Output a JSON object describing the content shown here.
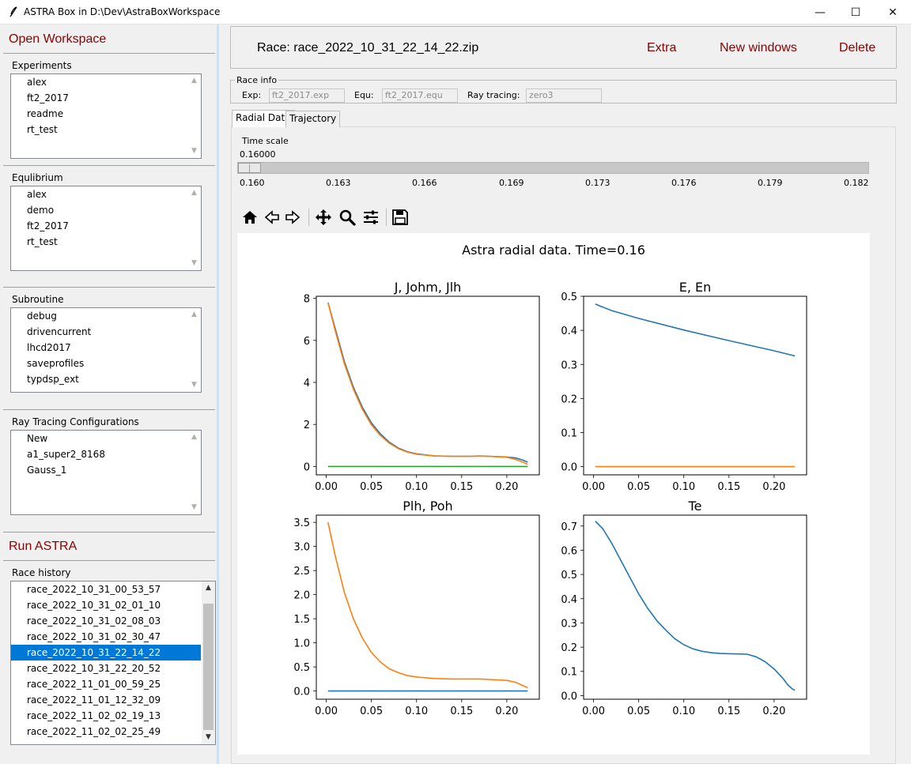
{
  "window": {
    "title": "ASTRA Box in D:\\Dev\\AstraBoxWorkspace",
    "minimize": "—",
    "maximize": "☐",
    "close": "✕"
  },
  "sidebar": {
    "open_workspace": "Open Workspace",
    "experiments": {
      "label": "Experiments",
      "items": [
        "alex",
        "ft2_2017",
        "readme",
        "rt_test"
      ]
    },
    "equilibrium": {
      "label": "Equlibrium",
      "items": [
        "alex",
        "demo",
        "ft2_2017",
        "rt_test"
      ]
    },
    "subroutine": {
      "label": "Subroutine",
      "items": [
        "debug",
        "drivencurrent",
        "lhcd2017",
        "saveprofiles",
        "typdsp_ext"
      ]
    },
    "ray_tracing": {
      "label": "Ray Tracing Configurations",
      "items": [
        "New",
        "a1_super2_8168",
        "Gauss_1"
      ]
    },
    "run_astra": "Run ASTRA",
    "race_history": {
      "label": "Race history",
      "selected_index": 4,
      "items": [
        "race_2022_10_31_00_53_57",
        "race_2022_10_31_02_01_10",
        "race_2022_10_31_02_08_03",
        "race_2022_10_31_02_30_47",
        "race_2022_10_31_22_14_22",
        "race_2022_10_31_22_20_52",
        "race_2022_11_01_00_59_25",
        "race_2022_11_01_12_32_09",
        "race_2022_11_02_02_19_13",
        "race_2022_11_02_02_25_49"
      ]
    }
  },
  "race": {
    "title": "Race: race_2022_10_31_22_14_22.zip",
    "extra": "Extra",
    "new_windows": "New windows",
    "delete": "Delete"
  },
  "race_info": {
    "legend": "Race info",
    "exp_label": "Exp:",
    "exp_value": "ft2_2017.exp",
    "equ_label": "Equ:",
    "equ_value": "ft2_2017.equ",
    "ray_label": "Ray tracing:",
    "ray_value": "zero3"
  },
  "tabs": [
    "Radial Data",
    "Trajectory"
  ],
  "active_tab": "Radial Data",
  "time_scale": {
    "label": "Time scale",
    "value": "0.16000",
    "ticks": [
      "0.160",
      "0.163",
      "0.166",
      "0.169",
      "0.173",
      "0.176",
      "0.179",
      "0.182"
    ]
  },
  "toolbar_icons": [
    "home-icon",
    "back-arrow-icon",
    "forward-arrow-icon",
    "pan-icon",
    "zoom-icon",
    "configure-subplots-icon",
    "save-icon"
  ],
  "colors": {
    "accent_red": "#8b0000",
    "selection": "#0078d7",
    "series_blue": "#1f77b4",
    "series_orange": "#ff7f0e",
    "series_green": "#2ca02c"
  },
  "chart_data": {
    "suptitle": "Astra radial data. Time=0.16",
    "panels": [
      {
        "type": "line",
        "title": "J, Johm, Jlh",
        "xlim": [
          -0.011,
          0.236
        ],
        "ylim": [
          -0.4,
          8.1
        ],
        "xticks": [
          0.0,
          0.05,
          0.1,
          0.15,
          0.2
        ],
        "xtick_labels": [
          "0.00",
          "0.05",
          "0.10",
          "0.15",
          "0.20"
        ],
        "yticks": [
          0,
          2,
          4,
          6,
          8
        ],
        "ytick_labels": [
          "0",
          "2",
          "4",
          "6",
          "8"
        ],
        "series": [
          {
            "color": "#1f77b4",
            "x": [
              0.002,
              0.01,
              0.02,
              0.03,
              0.04,
              0.05,
              0.06,
              0.07,
              0.08,
              0.09,
              0.1,
              0.12,
              0.14,
              0.16,
              0.17,
              0.18,
              0.2,
              0.21,
              0.218,
              0.223
            ],
            "y": [
              7.8,
              6.55,
              5.0,
              3.78,
              2.82,
              2.08,
              1.55,
              1.15,
              0.87,
              0.7,
              0.6,
              0.5,
              0.48,
              0.48,
              0.5,
              0.48,
              0.45,
              0.4,
              0.3,
              0.2
            ]
          },
          {
            "color": "#ff7f0e",
            "x": [
              0.002,
              0.01,
              0.02,
              0.03,
              0.04,
              0.05,
              0.06,
              0.07,
              0.08,
              0.09,
              0.1,
              0.12,
              0.14,
              0.16,
              0.17,
              0.18,
              0.2,
              0.21,
              0.218,
              0.223
            ],
            "y": [
              7.8,
              6.45,
              4.9,
              3.68,
              2.72,
              1.98,
              1.47,
              1.1,
              0.84,
              0.68,
              0.58,
              0.5,
              0.48,
              0.48,
              0.49,
              0.48,
              0.44,
              0.33,
              0.2,
              0.1
            ]
          },
          {
            "color": "#2ca02c",
            "x": [
              0.002,
              0.223
            ],
            "y": [
              0,
              0
            ]
          }
        ]
      },
      {
        "type": "line",
        "title": "E, En",
        "xlim": [
          -0.011,
          0.236
        ],
        "ylim": [
          -0.024,
          0.5
        ],
        "xticks": [
          0.0,
          0.05,
          0.1,
          0.15,
          0.2
        ],
        "xtick_labels": [
          "0.00",
          "0.05",
          "0.10",
          "0.15",
          "0.20"
        ],
        "yticks": [
          0.0,
          0.1,
          0.2,
          0.3,
          0.4,
          0.5
        ],
        "ytick_labels": [
          "0.0",
          "0.1",
          "0.2",
          "0.3",
          "0.4",
          "0.5"
        ],
        "series": [
          {
            "color": "#1f77b4",
            "x": [
              0.002,
              0.02,
              0.05,
              0.1,
              0.15,
              0.2,
              0.223
            ],
            "y": [
              0.477,
              0.458,
              0.435,
              0.401,
              0.37,
              0.34,
              0.325
            ]
          },
          {
            "color": "#ff7f0e",
            "x": [
              0.002,
              0.223
            ],
            "y": [
              0,
              0
            ]
          }
        ]
      },
      {
        "type": "line",
        "title": "Plh, Poh",
        "xlim": [
          -0.011,
          0.236
        ],
        "ylim": [
          -0.17,
          3.65
        ],
        "xticks": [
          0.0,
          0.05,
          0.1,
          0.15,
          0.2
        ],
        "xtick_labels": [
          "0.00",
          "0.05",
          "0.10",
          "0.15",
          "0.20"
        ],
        "yticks": [
          0.0,
          0.5,
          1.0,
          1.5,
          2.0,
          2.5,
          3.0,
          3.5
        ],
        "ytick_labels": [
          "0.0",
          "0.5",
          "1.0",
          "1.5",
          "2.0",
          "2.5",
          "3.0",
          "3.5"
        ],
        "series": [
          {
            "color": "#1f77b4",
            "x": [
              0.002,
              0.223
            ],
            "y": [
              0,
              0
            ]
          },
          {
            "color": "#ff7f0e",
            "x": [
              0.002,
              0.01,
              0.02,
              0.03,
              0.04,
              0.05,
              0.06,
              0.07,
              0.08,
              0.09,
              0.1,
              0.12,
              0.14,
              0.16,
              0.17,
              0.18,
              0.2,
              0.21,
              0.218,
              0.223
            ],
            "y": [
              3.5,
              2.8,
              2.05,
              1.5,
              1.1,
              0.8,
              0.6,
              0.46,
              0.38,
              0.32,
              0.29,
              0.26,
              0.25,
              0.25,
              0.25,
              0.24,
              0.22,
              0.18,
              0.11,
              0.07
            ]
          }
        ]
      },
      {
        "type": "line",
        "title": "Te",
        "xlim": [
          -0.011,
          0.236
        ],
        "ylim": [
          -0.015,
          0.745
        ],
        "xticks": [
          0.0,
          0.05,
          0.1,
          0.15,
          0.2
        ],
        "xtick_labels": [
          "0.00",
          "0.05",
          "0.10",
          "0.15",
          "0.20"
        ],
        "yticks": [
          0.0,
          0.1,
          0.2,
          0.3,
          0.4,
          0.5,
          0.6,
          0.7
        ],
        "ytick_labels": [
          "0.0",
          "0.1",
          "0.2",
          "0.3",
          "0.4",
          "0.5",
          "0.6",
          "0.7"
        ],
        "series": [
          {
            "color": "#1f77b4",
            "x": [
              0.002,
              0.01,
              0.02,
              0.03,
              0.04,
              0.05,
              0.06,
              0.07,
              0.08,
              0.09,
              0.1,
              0.11,
              0.12,
              0.13,
              0.14,
              0.15,
              0.16,
              0.17,
              0.18,
              0.19,
              0.2,
              0.21,
              0.215,
              0.22,
              0.223
            ],
            "y": [
              0.72,
              0.69,
              0.63,
              0.56,
              0.49,
              0.42,
              0.36,
              0.31,
              0.27,
              0.235,
              0.21,
              0.193,
              0.183,
              0.177,
              0.174,
              0.173,
              0.172,
              0.171,
              0.16,
              0.14,
              0.11,
              0.07,
              0.045,
              0.028,
              0.022
            ]
          }
        ]
      }
    ]
  }
}
